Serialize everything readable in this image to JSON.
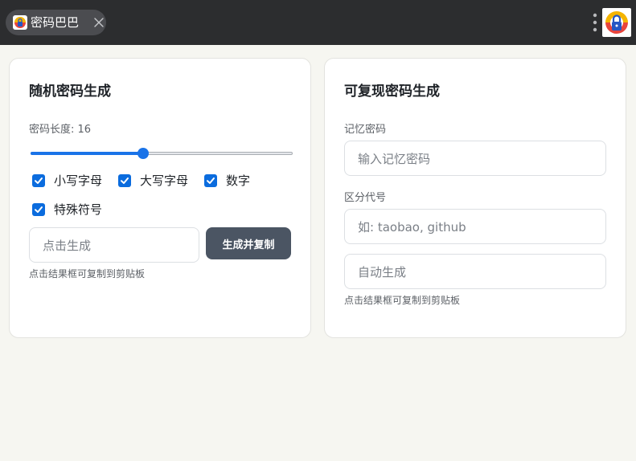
{
  "browser": {
    "tab": {
      "label": "密码巴巴",
      "icon": "lock-logo-icon"
    },
    "menu_icon": "kebab-menu-icon",
    "app_icon": "lock-logo-icon"
  },
  "random_panel": {
    "title": "随机密码生成",
    "length_label": "密码长度: 16",
    "length_slider": {
      "value": 16,
      "fraction": 0.43
    },
    "options": [
      {
        "label": "小写字母",
        "checked": true
      },
      {
        "label": "大写字母",
        "checked": true
      },
      {
        "label": "数字",
        "checked": true
      },
      {
        "label": "特殊符号",
        "checked": true
      }
    ],
    "result_placeholder": "点击生成",
    "generate_button": "生成并复制",
    "hint": "点击结果框可复制到剪贴板"
  },
  "reproducible_panel": {
    "title": "可复现密码生成",
    "memory_label": "记忆密码",
    "memory_placeholder": "输入记忆密码",
    "code_label": "区分代号",
    "code_placeholder": "如: taobao, github",
    "result_placeholder": "自动生成",
    "hint": "点击结果框可复制到剪贴板"
  },
  "colors": {
    "topbar": "#2c2d2f",
    "tab": "#4b4c50",
    "accent": "#1a73e8",
    "checkbox": "#0b6cde",
    "button": "#4b5563",
    "background": "#f6f6f1"
  }
}
